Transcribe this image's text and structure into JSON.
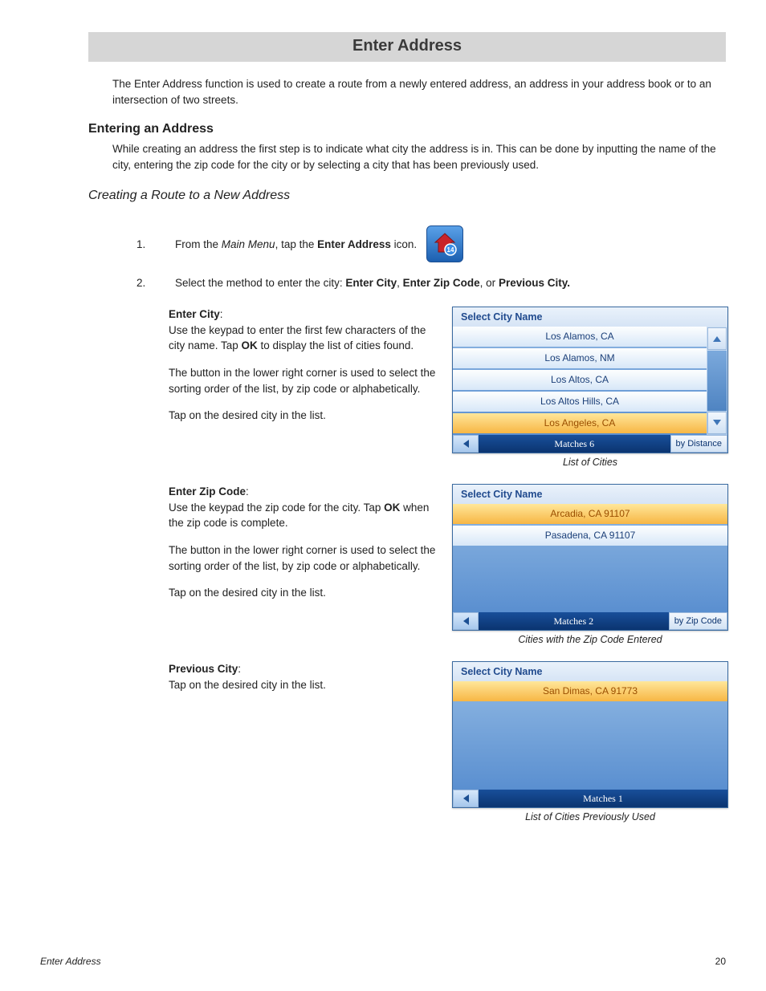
{
  "title": "Enter Address",
  "intro": "The Enter Address function is used to create a route from a newly entered address, an address in your address book or to an intersection of two streets.",
  "section1": {
    "heading": "Entering an Address",
    "para": "While creating an address the first step is to indicate what city the address is in.  This can be done by inputting the name of the city, entering the zip code for the city or by selecting a city that has been previously used."
  },
  "section2_heading": "Creating a Route to a New Address",
  "step1": {
    "num": "1.",
    "pre": "From the ",
    "menu": "Main Menu",
    "mid": ", tap the ",
    "bold": "Enter Address",
    "post": " icon."
  },
  "step2": {
    "num": "2.",
    "pre": "Select the method to enter the city: ",
    "b1": "Enter City",
    "m1": ", ",
    "b2": "Enter Zip Code",
    "m2": ", or ",
    "b3": "Previous City."
  },
  "enterCity": {
    "title": "Enter City",
    "p1a": "Use the keypad to enter the first few characters of the city name.  Tap ",
    "p1b": "OK",
    "p1c": " to display the list of cities found.",
    "p2": "The button in the lower right corner is used to select the sorting order of the list, by zip code or alphabetically.",
    "p3": "Tap on the desired city in the list.",
    "caption": "List of Cities"
  },
  "enterZip": {
    "title": "Enter Zip Code",
    "p1a": "Use the keypad the zip code for the city. Tap ",
    "p1b": "OK",
    "p1c": " when the zip code is complete.",
    "p2": "The button in the lower right corner is used to select the sorting order of the list, by zip code or alphabetically.",
    "p3": "Tap on the desired city in the list.",
    "caption": "Cities with the Zip Code Entered"
  },
  "prevCity": {
    "title": "Previous City",
    "p1": "Tap on the desired city in the list.",
    "caption": "List of Cities Previously Used"
  },
  "screen1": {
    "header": "Select City Name",
    "items": [
      "Los Alamos, CA",
      "Los Alamos, NM",
      "Los Altos, CA",
      "Los Altos Hills, CA",
      "Los Angeles, CA"
    ],
    "highlightIndex": 4,
    "matches": "Matches  6",
    "sort": "by Distance",
    "showScroll": true
  },
  "screen2": {
    "header": "Select City Name",
    "items": [
      "Arcadia, CA 91107",
      "Pasadena, CA 91107"
    ],
    "highlightIndex": 0,
    "matches": "Matches  2",
    "sort": "by Zip Code",
    "showScroll": false
  },
  "screen3": {
    "header": "Select City Name",
    "items": [
      "San Dimas, CA 91773"
    ],
    "highlightIndex": 0,
    "matches": "Matches  1",
    "sort": "",
    "showScroll": false
  },
  "footer": {
    "section": "Enter Address",
    "page": "20"
  }
}
